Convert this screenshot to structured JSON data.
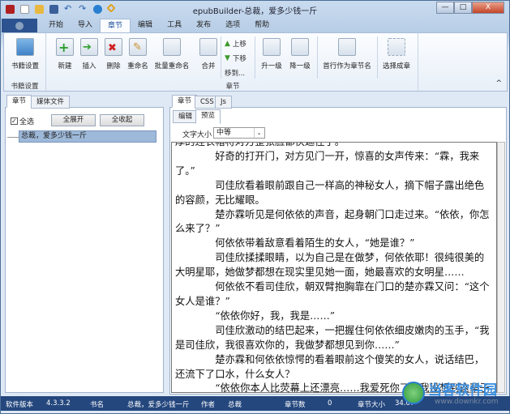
{
  "window": {
    "title": "epubBuilder-总裁，爱多少钱一斤",
    "minimize": "—",
    "maximize": "□",
    "close": "X"
  },
  "ribbon_tabs": [
    "开始",
    "导入",
    "章节",
    "编辑",
    "工具",
    "发布",
    "选项",
    "帮助"
  ],
  "ribbon": {
    "book_settings": "书籍设置",
    "book_group": "书籍设置",
    "new": "新建",
    "insert": "插入",
    "delete": "删除",
    "rename": "重命名",
    "batch_rename": "批量重命名",
    "merge": "合并",
    "move_up": "上移",
    "move_down": "下移",
    "move_to": "移到...",
    "promote": "升一级",
    "demote": "降一级",
    "first_line_title": "首行作为章节名",
    "select_chapter": "选择成章",
    "chapter_group": "章节",
    "collapse": "^"
  },
  "left": {
    "tabs": [
      "章节",
      "媒体文件"
    ],
    "select_all": "全选",
    "expand_all": "全展开",
    "collapse_all": "全收起",
    "tree": [
      "总裁，爱多少钱一斤"
    ]
  },
  "right": {
    "tabs": [
      "章节",
      "CSS",
      "Js"
    ],
    "subtabs": [
      "编辑",
      "预览"
    ],
    "font_size_label": "文字大小",
    "font_size_value": "中等",
    "paragraphs": [
      "厚的连衣帽将对方整张脸都快遮住了。",
      "好奇的打开门，对方见门一开，惊喜的女声传来：“霖，我来了。”",
      "司佳欣看着眼前跟自己一样高的神秘女人，摘下帽子露出绝色的容颜，无比耀眼。",
      "楚亦霖听见是何依依的声音，起身朝门口走过来。“依依，你怎么来了？”",
      "何依依带着敌意看着陌生的女人，“她是谁？”",
      "司佳欣揉揉眼睛，以为自己是在做梦，何依依耶！很纯很美的大明星耶，她做梦都想在现实里见她一面，她最喜欢的女明星……",
      "何依依不看司佳欣，朝双臂抱胸靠在门口的楚亦霖又问：“这个女人是谁？”",
      "“依依你好，我，我是……”",
      "司佳欣激动的结巴起来，一把握住何依依细皮嫩肉的玉手，“我是司佳欣，我很喜欢你的，我做梦都想见到你……”",
      "楚亦霖和何依依惊愕的看着眼前这个傻笑的女人，说话结巴，还流下了口水，什么女人？",
      "“依依你本人比荧幕上还漂亮……我爱死你了，我没想到这辈子能见到你，好激动好激动……”"
    ]
  },
  "status": {
    "version_label": "软件版本",
    "version": "4.3.3.2",
    "book_label": "书名",
    "book": "总裁，爱多少钱一斤",
    "author_label": "作者",
    "author": "总裁",
    "chapters_label": "章节数",
    "chapters": "0",
    "size_label": "章节大小",
    "size": "34.0?"
  },
  "watermark": {
    "text": "当客软件园",
    "url": "www.downkr.com"
  }
}
